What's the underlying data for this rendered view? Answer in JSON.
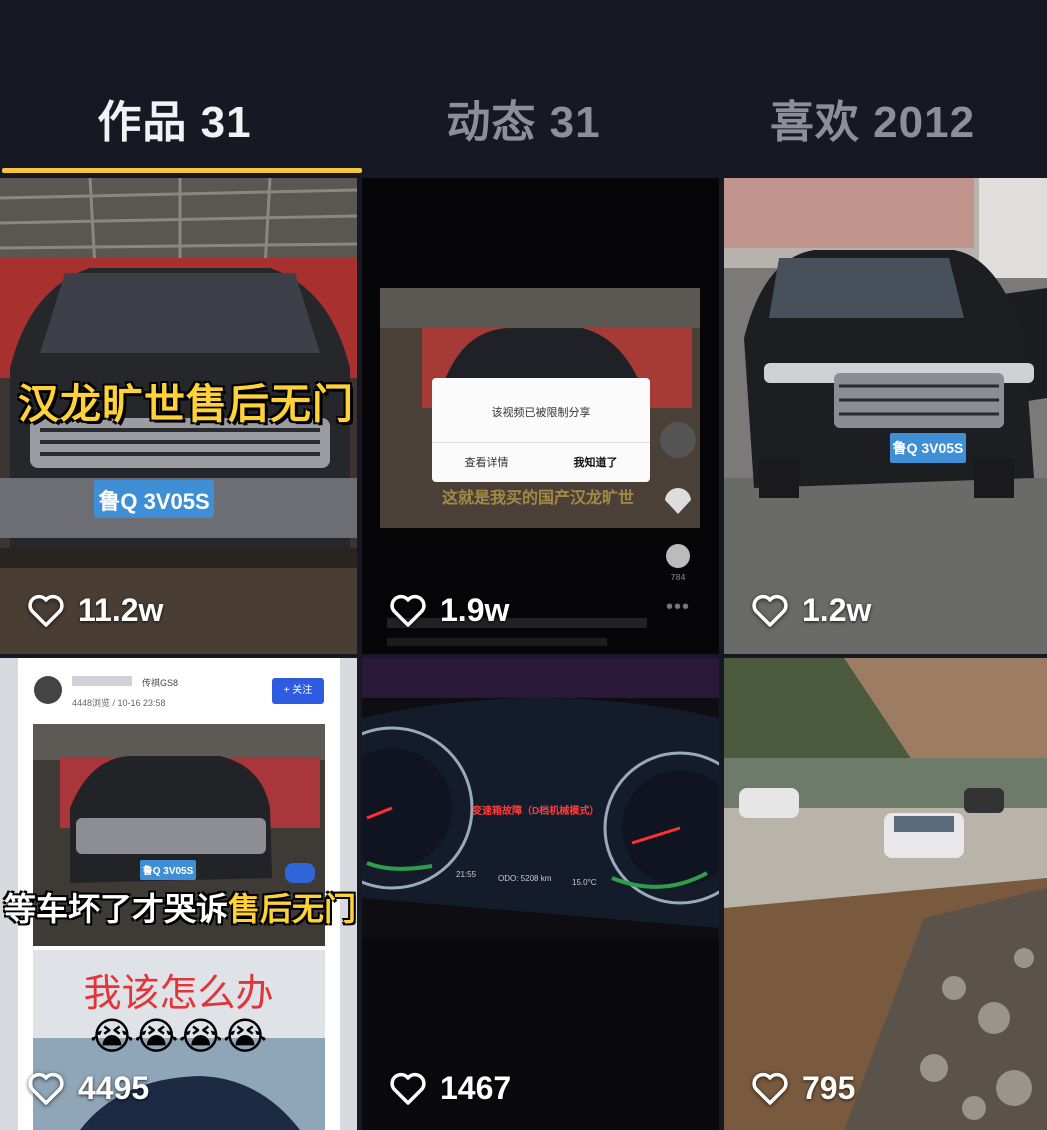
{
  "tabs": [
    {
      "label": "作品 31",
      "active": true
    },
    {
      "label": "动态 31",
      "active": false
    },
    {
      "label": "喜欢 2012",
      "active": false
    }
  ],
  "colors": {
    "background": "#161824",
    "tab_active": "#f2f2f4",
    "tab_inactive": "#8d8f98",
    "underline": "#f5c83a"
  },
  "videos": [
    {
      "likes": "11.2w",
      "caption": "汉龙旷世售后无门",
      "plate": "鲁Q 3V05S",
      "icon": "heart-outline-icon"
    },
    {
      "likes": "1.9w",
      "dialog_text": "该视频已被限制分享",
      "dialog_left_button": "查看详情",
      "dialog_right_button": "我知道了",
      "comment_count": "784",
      "caption_blurred": "这就是我买的国产汉龙旷世",
      "icon": "heart-outline-icon"
    },
    {
      "likes": "1.2w",
      "plate": "鲁Q 3V05S",
      "icon": "heart-outline-icon"
    },
    {
      "likes": "4495",
      "post_tag": "传祺GS8",
      "post_meta": "4448浏览 / 10-16 23:58",
      "follow_button": "+ 关注",
      "plate": "鲁Q 3V05S",
      "caption_prefix": "等车坏了才哭诉",
      "caption_highlight": "售后无门",
      "question": "我该怎么办",
      "emoji": "😭😭😭😭",
      "icon": "heart-outline-icon"
    },
    {
      "likes": "1467",
      "warning": "变速箱故障（D档机械模式）",
      "odo": "ODO: 5208 km",
      "time": "21:55",
      "temp": "15.0°C",
      "icon": "heart-outline-icon"
    },
    {
      "likes": "795",
      "icon": "heart-outline-icon"
    }
  ]
}
